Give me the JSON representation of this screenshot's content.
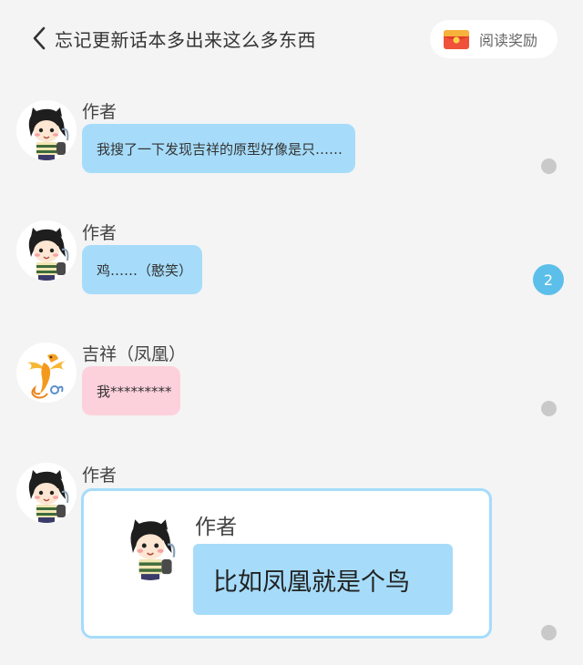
{
  "header": {
    "title": "忘记更新话本多出来这么多东西",
    "reward_label": "阅读奖励"
  },
  "messages": [
    {
      "sender": "作者",
      "text": "我搜了一下发现吉祥的原型好像是只……"
    },
    {
      "sender": "作者",
      "text": "鸡……（憨笑）"
    },
    {
      "sender": "吉祥（凤凰）",
      "text": "我*********"
    },
    {
      "sender": "作者"
    }
  ],
  "comment_count": "2",
  "quote": {
    "sender": "作者",
    "text": "比如凤凰就是个鸟"
  },
  "colors": {
    "background": "#f4f4f4",
    "author_bubble": "#a6dcfa",
    "phoenix_bubble": "#fdd1dc",
    "badge": "#5bbfea",
    "dot": "#c9c9c9"
  }
}
